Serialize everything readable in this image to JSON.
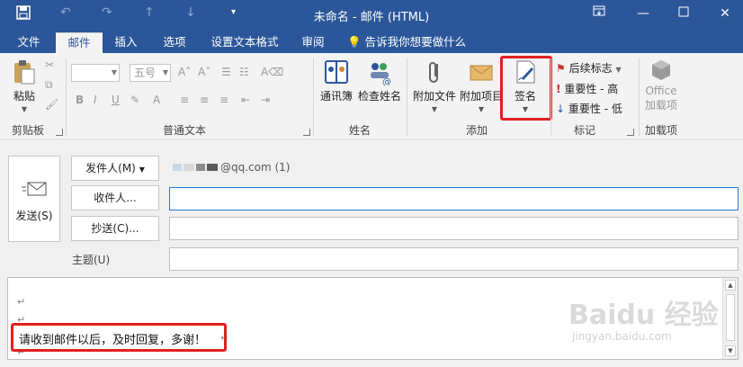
{
  "window": {
    "title": "未命名 - 邮件 (HTML)",
    "icons": [
      "save-icon",
      "undo-icon",
      "redo-icon",
      "up-arrow-icon",
      "down-arrow-icon",
      "customize-qat-icon",
      "ribbon-display-icon",
      "minimize-icon",
      "maximize-icon",
      "close-icon"
    ]
  },
  "tabs": [
    {
      "label": "文件"
    },
    {
      "label": "邮件"
    },
    {
      "label": "插入"
    },
    {
      "label": "选项"
    },
    {
      "label": "设置文本格式"
    },
    {
      "label": "审阅"
    },
    {
      "label": "告诉我你想要做什么"
    }
  ],
  "ribbon": {
    "clipboard": {
      "paste": "粘贴",
      "group": "剪贴板"
    },
    "basic_text": {
      "font_size": "五号",
      "group": "普通文本",
      "bold": "B",
      "italic": "I",
      "underline": "U"
    },
    "names": {
      "address_book": "通讯簿",
      "check_names": "检查姓名",
      "group": "姓名"
    },
    "include": {
      "attach_file": "附加文件",
      "attach_item": "附加项目",
      "signature": "签名",
      "group": "添加"
    },
    "tags": {
      "follow_up": "后续标志",
      "high": "重要性 - 高",
      "low": "重要性 - 低",
      "group": "标记"
    },
    "addins": {
      "office": "Office",
      "addins_label": "加载项",
      "group": "加载项"
    }
  },
  "compose": {
    "send": "发送(S)",
    "from_button": "发件人(M)",
    "from_value": "@qq.com (1)",
    "to_button": "收件人...",
    "cc_button": "抄送(C)...",
    "subject_label": "主题(U)",
    "body_text": "请收到邮件以后，及时回复，多谢！",
    "paragraph_mark": "↵"
  },
  "watermark": {
    "main": "Baidu 经验",
    "sub": "jingyan.baidu.com"
  },
  "colors": {
    "accent": "#2b579a",
    "highlight": "#e02020"
  }
}
